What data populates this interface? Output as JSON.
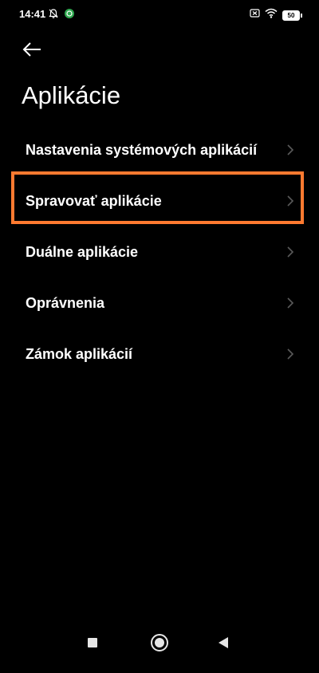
{
  "status_bar": {
    "time": "14:41",
    "battery": "50",
    "left_icons": [
      "bell-off-icon",
      "vpn-icon"
    ],
    "right_icons": [
      "sim-off-icon",
      "wifi-icon",
      "battery-icon"
    ]
  },
  "header": {
    "back_icon": "arrow-left-icon",
    "title": "Aplikácie"
  },
  "menu": {
    "items": [
      {
        "label": "Nastavenia systémových aplikácií"
      },
      {
        "label": "Spravovať aplikácie",
        "highlighted": true
      },
      {
        "label": "Duálne aplikácie"
      },
      {
        "label": "Oprávnenia"
      },
      {
        "label": "Zámok aplikácií"
      }
    ]
  },
  "highlight_color": "#ff7a30",
  "nav_bar": {
    "buttons": [
      "recents-button",
      "home-button",
      "back-button"
    ]
  }
}
